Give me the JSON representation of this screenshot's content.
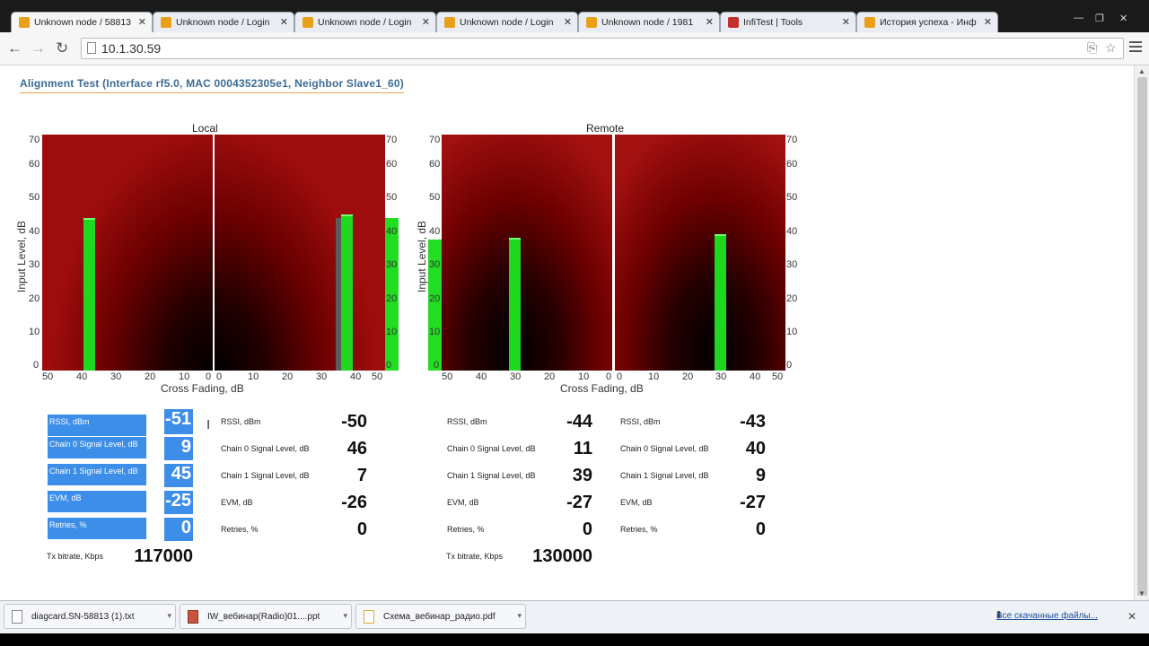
{
  "tabs": [
    {
      "label": "Unknown node / 58813",
      "active": true
    },
    {
      "label": "Unknown node / Login",
      "active": false
    },
    {
      "label": "Unknown node / Login",
      "active": false
    },
    {
      "label": "Unknown node / Login",
      "active": false
    },
    {
      "label": "Unknown node / 1981",
      "active": false
    },
    {
      "label": "InfiTest | Tools",
      "active": false
    },
    {
      "label": "История успеха - Инф",
      "active": false
    }
  ],
  "toolbar": {
    "url": "10.1.30.59"
  },
  "page": {
    "heading": "Alignment Test (Interface rf5.0, MAC 0004352305e1, Neighbor Slave1_60)"
  },
  "local": {
    "title": "Local",
    "ylabel": "Input Level, dB",
    "xlabel": "Cross Fading, dB",
    "left_ticks_x": [
      "50",
      "40",
      "30",
      "20",
      "10",
      "0"
    ],
    "right_ticks_x": [
      "0",
      "10",
      "20",
      "30",
      "40",
      "50"
    ],
    "y_ticks": [
      "70",
      "60",
      "50",
      "40",
      "30",
      "20",
      "10",
      "0"
    ]
  },
  "remote": {
    "title": "Remote",
    "ylabel": "Input Level, dB",
    "xlabel": "Cross Fading, dB",
    "left_ticks_x": [
      "50",
      "40",
      "30",
      "20",
      "10",
      "0"
    ],
    "right_ticks_x": [
      "0",
      "10",
      "20",
      "30",
      "40",
      "50"
    ],
    "y_ticks": [
      "70",
      "60",
      "50",
      "40",
      "30",
      "20",
      "10",
      "0"
    ]
  },
  "stats": {
    "labels": [
      "RSSI, dBm",
      "Chain 0 Signal Level, dB",
      "Chain 1 Signal Level, dB",
      "EVM, dB",
      "Retries, %"
    ],
    "local_a": [
      "-51",
      "9",
      "45",
      "-25",
      "0"
    ],
    "local_b": [
      "-50",
      "46",
      "7",
      "-26",
      "0"
    ],
    "remote_a": [
      "-44",
      "11",
      "39",
      "-27",
      "0"
    ],
    "remote_b": [
      "-43",
      "40",
      "9",
      "-27",
      "0"
    ],
    "tx_label": "Tx bitrate, Kbps",
    "local_tx": "117000",
    "remote_tx": "130000"
  },
  "downloads": {
    "items": [
      "diagcard.SN-58813 (1).txt",
      "IW_вебинар(Radio)01....ppt",
      "Схема_вебинар_радио.pdf"
    ],
    "all": "Все скачанные файлы..."
  }
}
